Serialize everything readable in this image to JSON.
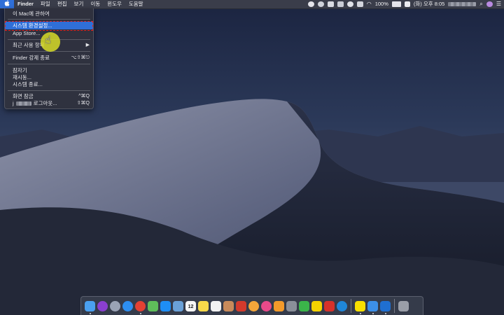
{
  "menubar": {
    "apple_label": "",
    "items": [
      "Finder",
      "파일",
      "편집",
      "보기",
      "이동",
      "윈도우",
      "도움말"
    ],
    "battery": "100%",
    "datetime": "(화) 오후 8:05"
  },
  "apple_menu": {
    "about": "이 Mac에 관하여",
    "system_prefs": "시스템 환경설정...",
    "app_store": "App Store...",
    "recent_items": "최근 사용 항목",
    "recent_arrow": "▶",
    "force_quit": "Finder 강제 종료",
    "force_quit_shortcut": "⌥⇧⌘⎋",
    "sleep": "잠자기",
    "restart": "재시동...",
    "shutdown": "시스템 종료...",
    "lock_screen": "화면 잠금",
    "lock_shortcut": "^⌘Q",
    "logout_prefix": "j",
    "logout_suffix": "로그아웃...",
    "logout_shortcut": "⇧⌘Q"
  },
  "dock": {
    "icons": [
      {
        "name": "finder-icon",
        "color": "#4aa0f0"
      },
      {
        "name": "siri-icon",
        "color": "#8a3fd0"
      },
      {
        "name": "launchpad-icon",
        "color": "#9aa3b5"
      },
      {
        "name": "safari-icon",
        "color": "#2d8ef0"
      },
      {
        "name": "chrome-icon",
        "color": "#e34133"
      },
      {
        "name": "maps-icon",
        "color": "#5fbd5a"
      },
      {
        "name": "app-store-icon",
        "color": "#1e8ef5"
      },
      {
        "name": "photos-preview-icon",
        "color": "#6aa1d8"
      },
      {
        "name": "calendar-icon",
        "color": "#f5f5f5"
      },
      {
        "name": "notes-icon",
        "color": "#f8d94a"
      },
      {
        "name": "reminders-icon",
        "color": "#f2f2f2"
      },
      {
        "name": "contacts-icon",
        "color": "#c88a5a"
      },
      {
        "name": "photo-booth-icon",
        "color": "#d33a2c"
      },
      {
        "name": "photos-icon",
        "color": "#f4a63a"
      },
      {
        "name": "itunes-icon",
        "color": "#e84a8a"
      },
      {
        "name": "ibooks-icon",
        "color": "#f39a2a"
      },
      {
        "name": "system-preferences-icon",
        "color": "#8a8f99"
      },
      {
        "name": "evernote-icon",
        "color": "#3bb54a"
      },
      {
        "name": "kakaotalk-yellow-icon",
        "color": "#f5d300"
      },
      {
        "name": "flashcard-icon",
        "color": "#d6312a"
      },
      {
        "name": "edge-icon",
        "color": "#1f86d8"
      },
      {
        "name": "kakaotalk-icon",
        "color": "#f9e000"
      },
      {
        "name": "icloud-icon",
        "color": "#3c8fe8"
      },
      {
        "name": "teamviewer-icon",
        "color": "#1f6fd1"
      },
      {
        "name": "trash-icon",
        "color": "#9a9ea8"
      }
    ],
    "calendar_day": "12"
  }
}
